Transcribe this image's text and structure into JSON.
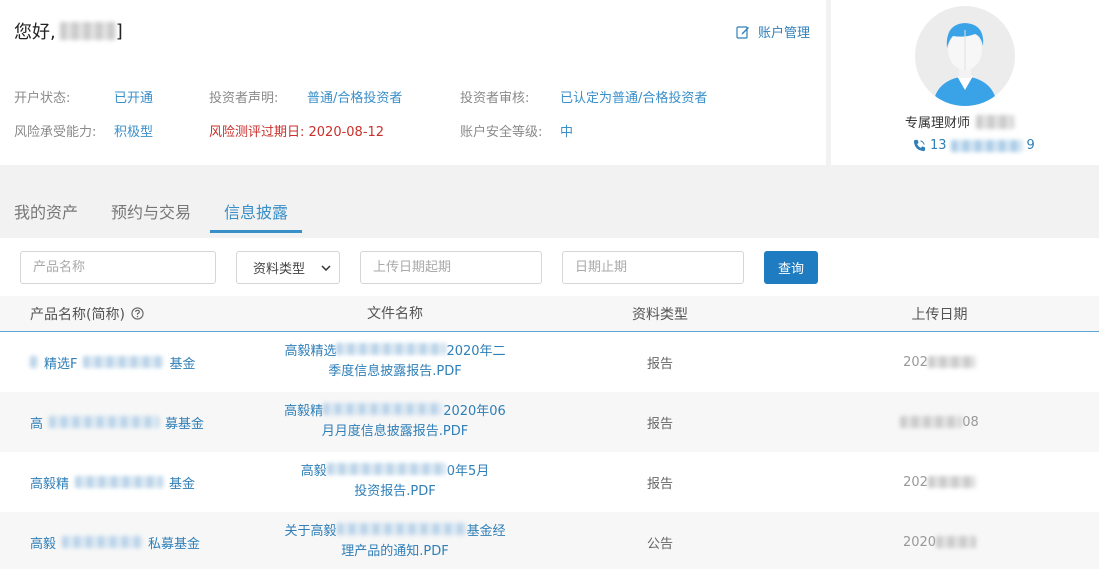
{
  "header": {
    "greeting": "您好,",
    "greeting_suffix": "]",
    "account_manage": "账户管理"
  },
  "account_info": {
    "open_status_label": "开户状态:",
    "open_status_value": "已开通",
    "investor_declaration_label": "投资者声明:",
    "investor_declaration_value": "普通/合格投资者",
    "investor_review_label": "投资者审核:",
    "investor_review_value": "已认定为普通/合格投资者",
    "risk_tolerance_label": "风险承受能力:",
    "risk_tolerance_value": "积极型",
    "risk_test_expiry": "风险测评过期日: 2020-08-12",
    "security_level_label": "账户安全等级:",
    "security_level_value": "中"
  },
  "advisor": {
    "title": "专属理财师",
    "phone_prefix": "13",
    "phone_suffix": "9"
  },
  "tabs": [
    {
      "label": "我的资产"
    },
    {
      "label": "预约与交易"
    },
    {
      "label": "信息披露"
    }
  ],
  "active_tab": "信息披露",
  "filters": {
    "product_name_placeholder": "产品名称",
    "doc_type_selected": "资料类型",
    "upload_start_placeholder": "上传日期起期",
    "upload_end_placeholder": "日期止期",
    "query_label": "查询"
  },
  "table": {
    "headers": {
      "product": "产品名称(简称)",
      "file": "文件名称",
      "type": "资料类型",
      "date": "上传日期"
    },
    "rows": [
      {
        "product_a": "精选F",
        "product_b": "基金",
        "file_a": "高毅精选",
        "file_b": "2020年二",
        "file_c": "季度信息披露报告.PDF",
        "type": "报告",
        "date_a": "202",
        "date_b": ""
      },
      {
        "product_a": "高",
        "product_b": "募基金",
        "file_a": "高毅精",
        "file_b": "2020年06",
        "file_c": "月月度信息披露报告.PDF",
        "type": "报告",
        "date_a": "",
        "date_b": "08"
      },
      {
        "product_a": "高毅精",
        "product_b": "基金",
        "file_a": "高毅",
        "file_b": "0年5月",
        "file_c": "投资报告.PDF",
        "type": "报告",
        "date_a": "202",
        "date_b": ""
      },
      {
        "product_a": "高毅",
        "product_b": "私募基金",
        "file_a": "关于高毅",
        "file_b": "基金经",
        "file_c": "理产品的通知.PDF",
        "type": "公告",
        "date_a": "2020",
        "date_b": ""
      }
    ]
  },
  "icons": {
    "edit": "edit-icon",
    "phone": "phone-icon",
    "help": "help-circle-icon",
    "chevron": "chevron-down-icon",
    "avatar": "user-avatar-icon"
  },
  "colors": {
    "accent": "#3a8fc9",
    "button": "#1f7cc1",
    "warning": "#c9302c"
  }
}
